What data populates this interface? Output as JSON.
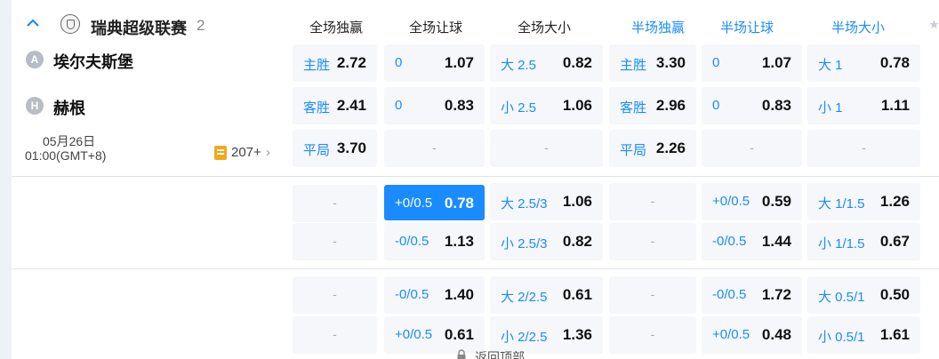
{
  "league": {
    "name": "瑞典超级联赛",
    "count": "2"
  },
  "columns": {
    "full_win": "全场独赢",
    "full_handicap": "全场让球",
    "full_total": "全场大小",
    "half_win": "半场独赢",
    "half_handicap": "半场让球",
    "half_total": "半场大小"
  },
  "teams": {
    "away": {
      "badge": "A",
      "name": "埃尔夫斯堡"
    },
    "home": {
      "badge": "H",
      "name": "赫根"
    }
  },
  "match": {
    "date": "05月26日",
    "time": "01:00(GMT+8)",
    "more_bets": "207+",
    "more_chevron": "›"
  },
  "dash": "-",
  "main_market": {
    "row1": {
      "full_win": {
        "label": "主胜",
        "value": "2.72"
      },
      "full_handicap": {
        "label": "0",
        "value": "1.07"
      },
      "full_total": {
        "label": "大 2.5",
        "value": "0.82"
      },
      "half_win": {
        "label": "主胜",
        "value": "3.30"
      },
      "half_handicap": {
        "label": "0",
        "value": "1.07"
      },
      "half_total": {
        "label": "大 1",
        "value": "0.78"
      }
    },
    "row2": {
      "full_win": {
        "label": "客胜",
        "value": "2.41"
      },
      "full_handicap": {
        "label": "0",
        "value": "0.83"
      },
      "full_total": {
        "label": "小 2.5",
        "value": "1.06"
      },
      "half_win": {
        "label": "客胜",
        "value": "2.96"
      },
      "half_handicap": {
        "label": "0",
        "value": "0.83"
      },
      "half_total": {
        "label": "小 1",
        "value": "1.11"
      }
    },
    "row3": {
      "full_win": {
        "label": "平局",
        "value": "3.70"
      },
      "half_win": {
        "label": "平局",
        "value": "2.26"
      }
    }
  },
  "alt_market_1": {
    "row1": {
      "full_handicap": {
        "label": "+0/0.5",
        "value": "0.78",
        "selected": true
      },
      "full_total": {
        "label": "大 2.5/3",
        "value": "1.06"
      },
      "half_handicap": {
        "label": "+0/0.5",
        "value": "0.59"
      },
      "half_total": {
        "label": "大 1/1.5",
        "value": "1.26"
      }
    },
    "row2": {
      "full_handicap": {
        "label": "-0/0.5",
        "value": "1.13"
      },
      "full_total": {
        "label": "小 2.5/3",
        "value": "0.82"
      },
      "half_handicap": {
        "label": "-0/0.5",
        "value": "1.44"
      },
      "half_total": {
        "label": "小 1/1.5",
        "value": "0.67"
      }
    }
  },
  "alt_market_2": {
    "row1": {
      "full_handicap": {
        "label": "-0/0.5",
        "value": "1.40"
      },
      "full_total": {
        "label": "大 2/2.5",
        "value": "0.61"
      },
      "half_handicap": {
        "label": "-0/0.5",
        "value": "1.72"
      },
      "half_total": {
        "label": "大 0.5/1",
        "value": "0.50"
      }
    },
    "row2": {
      "full_handicap": {
        "label": "+0/0.5",
        "value": "0.61"
      },
      "full_total": {
        "label": "小 2/2.5",
        "value": "1.36"
      },
      "half_handicap": {
        "label": "+0/0.5",
        "value": "0.48"
      },
      "half_total": {
        "label": "小 0.5/1",
        "value": "1.61"
      }
    }
  },
  "back_to_top": "返回顶部",
  "colors": {
    "accent": "#1a8cff",
    "cell_bg": "#f5f7fa",
    "page_bg": "#eef1f6"
  }
}
